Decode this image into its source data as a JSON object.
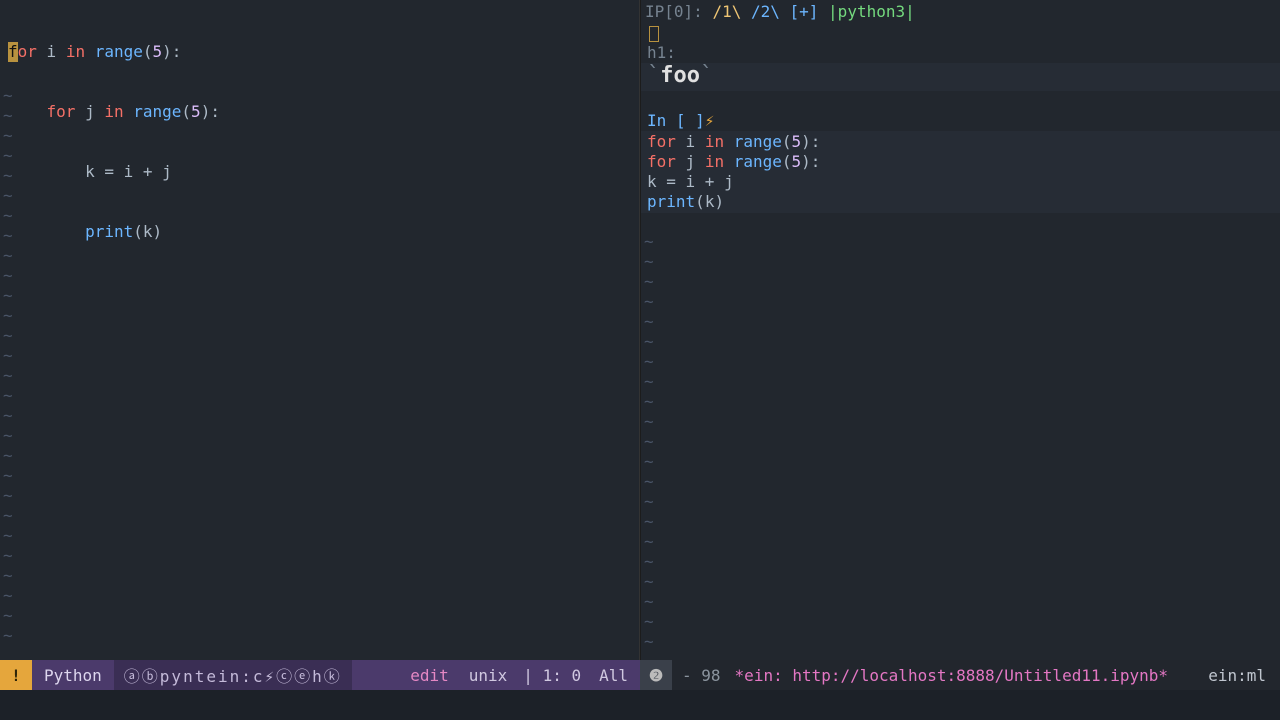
{
  "left_pane": {
    "code": {
      "l1_for": "or",
      "l1_i": " i ",
      "l1_in": "in",
      "l1_range": " range",
      "l1_paren_o": "(",
      "l1_num": "5",
      "l1_paren_c": ")",
      "l1_colon": ":",
      "l2_indent": "    ",
      "l2_for": "for",
      "l2_j": " j ",
      "l2_in": "in",
      "l2_range": " range",
      "l2_paren_o": "(",
      "l2_num": "5",
      "l2_paren_c": ")",
      "l2_colon": ":",
      "l3": "        k = i + j",
      "l4_indent": "        ",
      "l4_print": "print",
      "l4_paren_o": "(",
      "l4_k": "k",
      "l4_paren_c": ")"
    },
    "cursor_char": "f"
  },
  "right_pane": {
    "ip_header": {
      "prefix": "IP[0]: ",
      "tab1": "/1\\",
      "tab2": " /2\\",
      "plus": " [+] ",
      "kernel": " |python3|"
    },
    "h1_label": "h1:",
    "foo_bt": "`",
    "foo": "foo",
    "in_prompt": "In [ ]",
    "lightning": "⚡",
    "code": {
      "l1_for": "for",
      "l1_i": " i ",
      "l1_in": "in",
      "l1_range": " range",
      "l1_paren_o": "(",
      "l1_num": "5",
      "l1_paren_c": ")",
      "l1_colon": ":",
      "l2_indent": "    ",
      "l2_for": "for",
      "l2_j": " j ",
      "l2_in": "in",
      "l2_range": " range",
      "l2_paren_o": "(",
      "l2_num": "5",
      "l2_paren_c": ")",
      "l2_colon": ":",
      "l3": "        k = i + j",
      "l4_indent": "        ",
      "l4_print": "print",
      "l4_paren_o": "(",
      "l4_k": "k",
      "l4_paren_c": ")"
    }
  },
  "modeline_left": {
    "badge": "!",
    "lang": "Python",
    "icons": "ⓐⓑpyntein:c⚡ⓒⓔhⓚ",
    "edit": "edit",
    "unix": "unix",
    "pos": "| 1: 0",
    "all": "All"
  },
  "modeline_right": {
    "badge": "❷",
    "pos_pre": "-",
    "pos": "98",
    "buf": "*ein: http://localhost:8888/Untitled11.ipynb*",
    "mode": "ein:ml"
  }
}
